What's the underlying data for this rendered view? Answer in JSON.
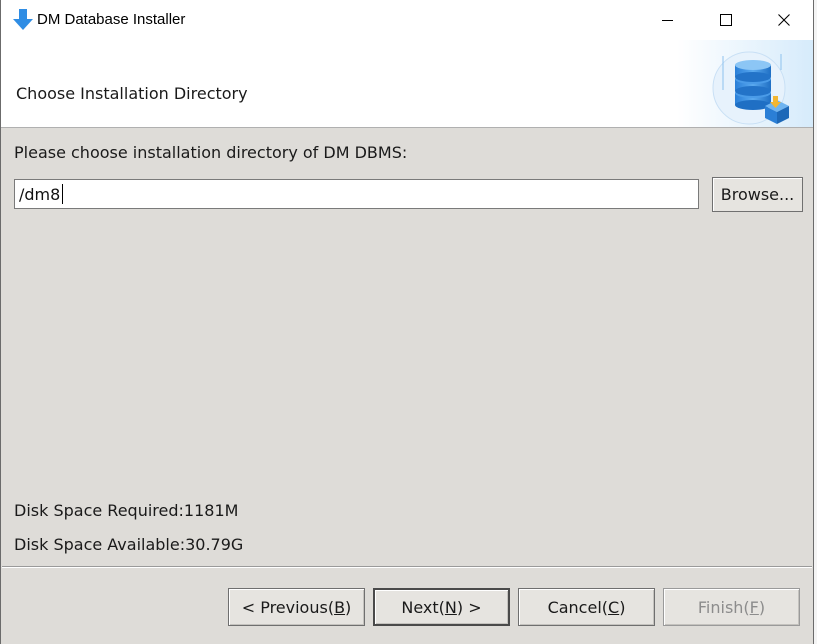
{
  "window": {
    "title": "DM Database Installer",
    "controls": {
      "minimize": "minimize-icon",
      "maximize": "maximize-icon",
      "close": "close-icon"
    }
  },
  "header": {
    "title": "Choose Installation Directory",
    "art": "database-installer-icon"
  },
  "body": {
    "prompt": "Please choose installation directory of DM DBMS:",
    "path_value": "/dm8",
    "browse_label": "Browse...",
    "disk_required": "Disk Space Required:1181M",
    "disk_available": "Disk Space Available:30.79G"
  },
  "buttons": {
    "previous": {
      "pre": "< Previous(",
      "key": "B",
      "post": ")"
    },
    "next": {
      "pre": "Next(",
      "key": "N",
      "post": ") >"
    },
    "cancel": {
      "pre": "Cancel(",
      "key": "C",
      "post": ")"
    },
    "finish": {
      "pre": "Finish(",
      "key": "F",
      "post": ")",
      "enabled": false
    }
  },
  "colors": {
    "window_bg": "#dedcd8",
    "accent_blue": "#2f8de4",
    "disabled_text": "#8c8c8c"
  }
}
